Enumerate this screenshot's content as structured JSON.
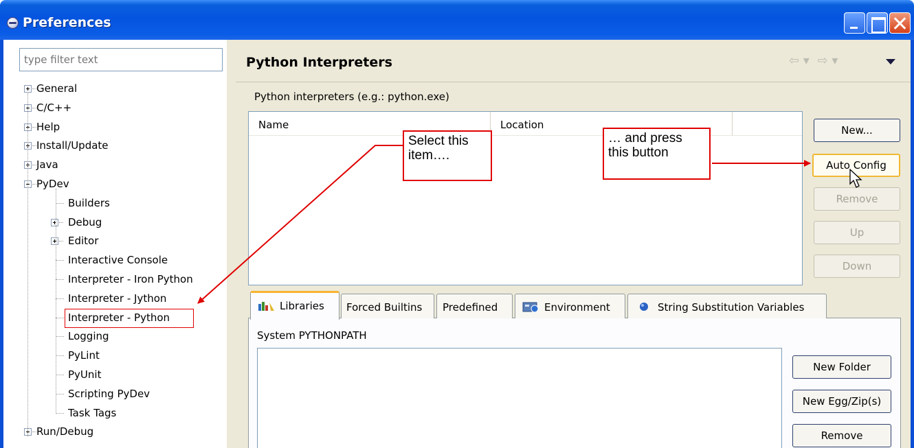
{
  "window": {
    "title": "Preferences"
  },
  "filter": {
    "placeholder": "type filter text"
  },
  "tree": [
    {
      "label": "General",
      "level": 0,
      "expander": "plus"
    },
    {
      "label": "C/C++",
      "level": 0,
      "expander": "plus"
    },
    {
      "label": "Help",
      "level": 0,
      "expander": "plus"
    },
    {
      "label": "Install/Update",
      "level": 0,
      "expander": "plus"
    },
    {
      "label": "Java",
      "level": 0,
      "expander": "plus"
    },
    {
      "label": "PyDev",
      "level": 0,
      "expander": "minus"
    },
    {
      "label": "Builders",
      "level": 1,
      "expander": "none"
    },
    {
      "label": "Debug",
      "level": 1,
      "expander": "plus"
    },
    {
      "label": "Editor",
      "level": 1,
      "expander": "plus"
    },
    {
      "label": "Interactive Console",
      "level": 1,
      "expander": "none"
    },
    {
      "label": "Interpreter - Iron Python",
      "level": 1,
      "expander": "none"
    },
    {
      "label": "Interpreter - Jython",
      "level": 1,
      "expander": "none"
    },
    {
      "label": "Interpreter - Python",
      "level": 1,
      "expander": "none",
      "highlighted": true
    },
    {
      "label": "Logging",
      "level": 1,
      "expander": "none"
    },
    {
      "label": "PyLint",
      "level": 1,
      "expander": "none"
    },
    {
      "label": "PyUnit",
      "level": 1,
      "expander": "none"
    },
    {
      "label": "Scripting PyDev",
      "level": 1,
      "expander": "none"
    },
    {
      "label": "Task Tags",
      "level": 1,
      "expander": "none"
    },
    {
      "label": "Run/Debug",
      "level": 0,
      "expander": "plus"
    }
  ],
  "page": {
    "title": "Python Interpreters",
    "section_label": "Python interpreters (e.g.: python.exe)",
    "table_columns": [
      "Name",
      "Location"
    ],
    "buttons": {
      "new": "New...",
      "auto_config": "Auto Config",
      "remove": "Remove",
      "up": "Up",
      "down": "Down"
    },
    "tabs": [
      "Libraries",
      "Forced Builtins",
      "Predefined",
      "Environment",
      "String Substitution Variables"
    ],
    "active_tab": "Libraries",
    "syspath_label": "System PYTHONPATH",
    "path_buttons": {
      "new_folder": "New Folder",
      "new_egg": "New Egg/Zip(s)",
      "remove": "Remove"
    }
  },
  "annotations": {
    "select_item": "Select this item….",
    "press_button": "… and press this button"
  },
  "colors": {
    "title_bar": "#0554e0",
    "annotation": "#e00000",
    "dialog_bg": "#ece9d8",
    "hover_border": "#f0b832"
  }
}
